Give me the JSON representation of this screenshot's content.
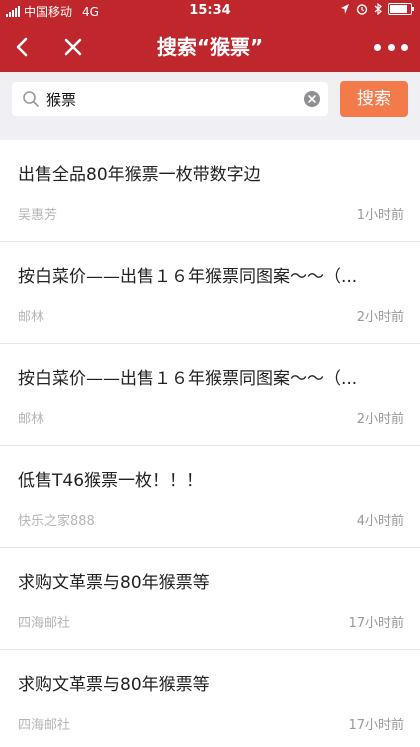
{
  "status_bar": {
    "carrier": "中国移动",
    "network": "4G",
    "time": "15:34"
  },
  "nav": {
    "title": "搜索“猴票”"
  },
  "search": {
    "query": "猴票",
    "button_label": "搜索"
  },
  "results": [
    {
      "title": "出售全品80年猴票一枚带数字边",
      "author": "吴惠芳",
      "time": "1小时前"
    },
    {
      "title": "按白菜价——出售１６年猴票同图案～～（...",
      "author": "邮林",
      "time": "2小时前"
    },
    {
      "title": "按白菜价——出售１６年猴票同图案～～（...",
      "author": "邮林",
      "time": "2小时前"
    },
    {
      "title": "低售T46猴票一枚！！！",
      "author": "快乐之家888",
      "time": "4小时前"
    },
    {
      "title": "求购文革票与80年猴票等",
      "author": "四海邮社",
      "time": "17小时前"
    },
    {
      "title": "求购文革票与80年猴票等",
      "author": "四海邮社",
      "time": "17小时前"
    }
  ],
  "colors": {
    "header": "#c0272d",
    "search_button": "#f37a4b",
    "background": "#efeff4"
  }
}
